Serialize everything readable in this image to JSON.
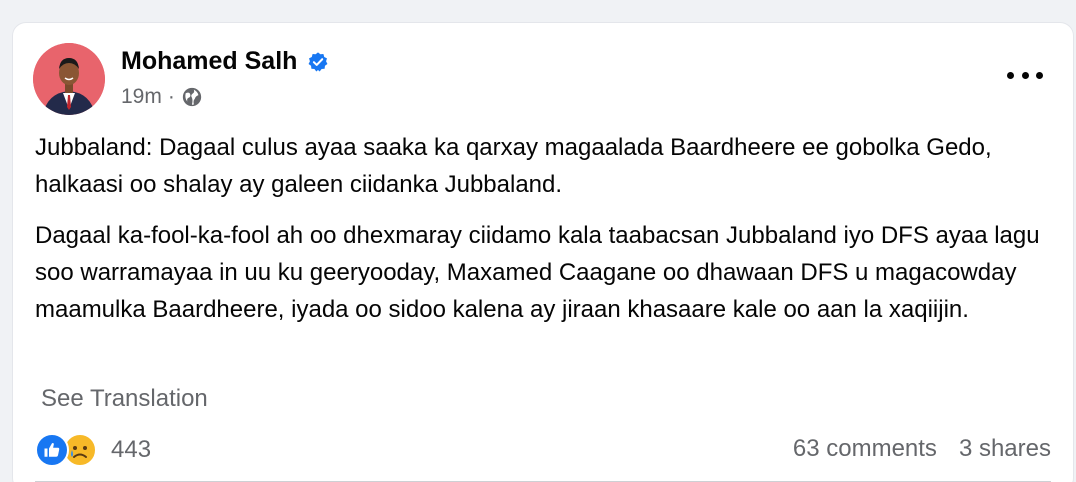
{
  "post": {
    "author": "Mohamed Salh",
    "verified": true,
    "time": "19m",
    "separator": "·",
    "audience_icon": "globe-icon",
    "paragraphs": [
      "Jubbaland: Dagaal culus ayaa saaka ka qarxay magaalada Baardheere ee gobolka Gedo, halkaasi oo shalay ay galeen ciidanka Jubbaland.",
      "Dagaal ka-fool-ka-fool ah oo dhexmaray ciidamo kala taabacsan Jubbaland iyo DFS ayaa lagu soo warramayaa in uu ku geeryooday, Maxamed Caagane oo dhawaan DFS u magacowday maamulka Baardheere, iyada oo sidoo kalena ay jiraan khasaare kale oo aan la xaqiijin."
    ],
    "see_translation": "See Translation",
    "reaction_count": "443",
    "reactions": [
      "like",
      "sad"
    ],
    "comments": "63 comments",
    "shares": "3 shares"
  },
  "colors": {
    "accent": "#1877f2",
    "text": "#050505",
    "secondary_text": "#65676b",
    "avatar_bg": "#e8646c"
  }
}
